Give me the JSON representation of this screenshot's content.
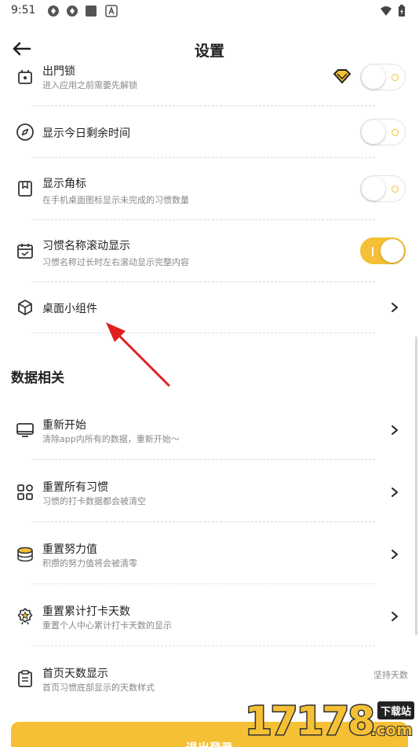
{
  "status_bar": {
    "time": "9:51"
  },
  "header": {
    "title": "设置"
  },
  "rows": [
    {
      "title": "出門锁",
      "subtitle": "进入应用之前需要先解锁",
      "toggle": false,
      "icon": "lock-icon"
    },
    {
      "title": "显示今日剩余时间",
      "subtitle": "",
      "toggle": false,
      "icon": "compass-icon"
    },
    {
      "title": "显示角标",
      "subtitle": "在手机桌面图标显示未完成的习惯数量",
      "toggle": false,
      "icon": "bookmark-icon"
    },
    {
      "title": "习惯名称滚动显示",
      "subtitle": "习惯名称过长时左右滚动显示完整内容",
      "toggle": true,
      "icon": "calendar-icon"
    },
    {
      "title": "桌面小组件",
      "subtitle": "",
      "icon": "widget-icon"
    }
  ],
  "data_section": {
    "title": "数据相关",
    "items": [
      {
        "title": "重新开始",
        "subtitle": "清除app内所有的数据，重新开始～",
        "icon": "monitor-icon"
      },
      {
        "title": "重置所有习惯",
        "subtitle": "习惯的打卡数据都会被清空",
        "icon": "grid-icon"
      },
      {
        "title": "重置努力值",
        "subtitle": "积攒的努力值将会被清零",
        "icon": "coins-icon"
      },
      {
        "title": "重置累计打卡天数",
        "subtitle": "重置个人中心累计打卡天数的显示",
        "icon": "star-badge-icon"
      },
      {
        "title": "首页天数显示",
        "subtitle": "首页习惯底部显示的天数样式",
        "icon": "clipboard-icon",
        "value": "坚持天数"
      }
    ]
  },
  "logout": {
    "label": "退出登录"
  },
  "watermark": {
    "digits": "17178",
    "tag": "下载站",
    "suffix": ".com"
  },
  "colors": {
    "accent": "#f5c035",
    "arrow": "#e02020"
  }
}
